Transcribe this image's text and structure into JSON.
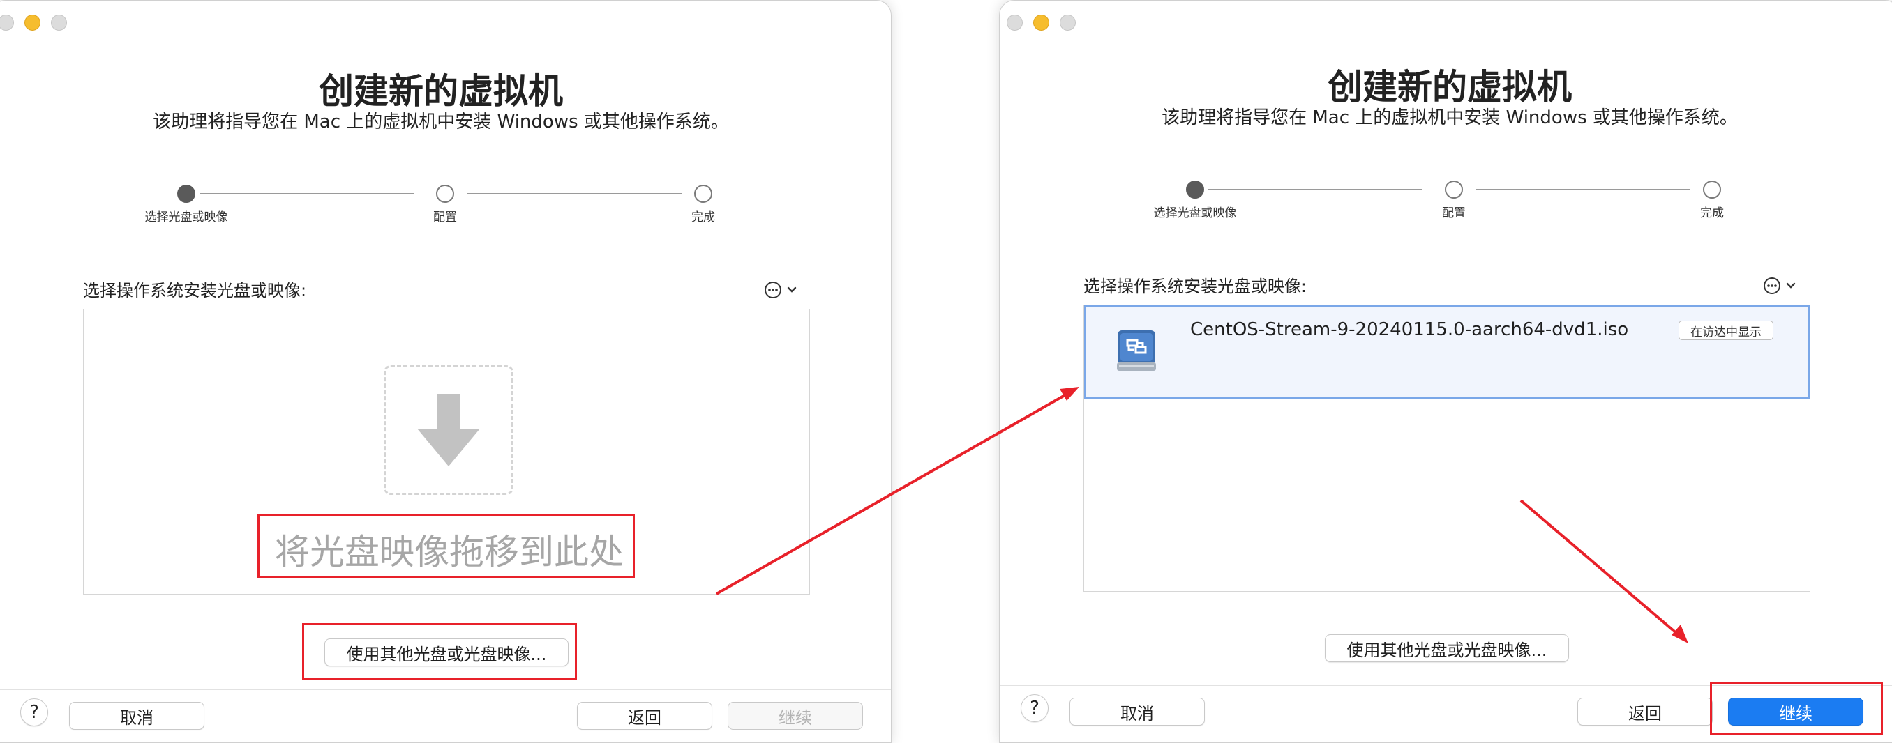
{
  "header": {
    "title": "创建新的虚拟机",
    "subtitle": "该助理将指导您在 Mac 上的虚拟机中安装 Windows 或其他操作系统。"
  },
  "steps": [
    {
      "label": "选择光盘或映像",
      "active": true
    },
    {
      "label": "配置",
      "active": false
    },
    {
      "label": "完成",
      "active": false
    }
  ],
  "source": {
    "label": "选择操作系统安装光盘或映像:",
    "more_icon": "ellipsis-circle-icon",
    "chevron_icon": "chevron-down-icon"
  },
  "drop_zone": {
    "icon": "down-arrow-icon",
    "text": "将光盘映像拖移到此处"
  },
  "selected_image": {
    "icon": "disc-image-icon",
    "filename": "CentOS-Stream-9-20240115.0-aarch64-dvd1.iso",
    "reveal_label": "在访达中显示"
  },
  "buttons": {
    "other_image": "使用其他光盘或光盘映像...",
    "help": "?",
    "cancel": "取消",
    "back": "返回",
    "continue": "继续"
  },
  "colors": {
    "annotation": "#e8212a",
    "accent": "#1b7cf2",
    "selection_border": "#7aa7e8",
    "close": "#dcdcdc",
    "minimize": "#f6bd2e"
  }
}
